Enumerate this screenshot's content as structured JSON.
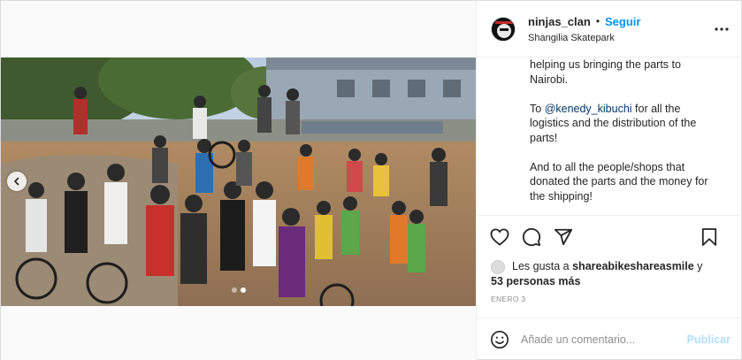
{
  "post": {
    "username": "ninjas_clan",
    "separator": "•",
    "follow_label": "Seguir",
    "location": "Shangilia Skatepark",
    "caption": {
      "line1": "helping us bringing the parts to",
      "line2": "Nairobi.",
      "mention": "@kenedy_kibuchi",
      "para2_prefix": "To ",
      "para2_rest": " for all the",
      "para2_line2": "logistics and the distribution of the",
      "para2_line3": "parts!",
      "para3_line1": "And to all the people/shops that",
      "para3_line2": "donated the parts and the money for",
      "para3_line3": "the shipping!"
    },
    "likes": {
      "prefix": "Les gusta a ",
      "user": "shareabikeshareasmile",
      "connector": " y",
      "others": "53 personas más"
    },
    "date": "ENERO 3",
    "comment": {
      "placeholder": "Añade un comentario...",
      "publish_label": "Publicar"
    },
    "carousel": {
      "slides": 2,
      "active_index": 1
    }
  },
  "icons": {
    "more": "more-options-icon",
    "like": "heart-icon",
    "comment": "comment-icon",
    "share": "share-icon",
    "save": "bookmark-icon",
    "emoji": "emoji-icon",
    "prev": "chevron-left-icon"
  },
  "colors": {
    "accent": "#0095f6",
    "publish_disabled": "#b2dffc",
    "mention": "#00376b",
    "muted": "#8e8e8e"
  }
}
